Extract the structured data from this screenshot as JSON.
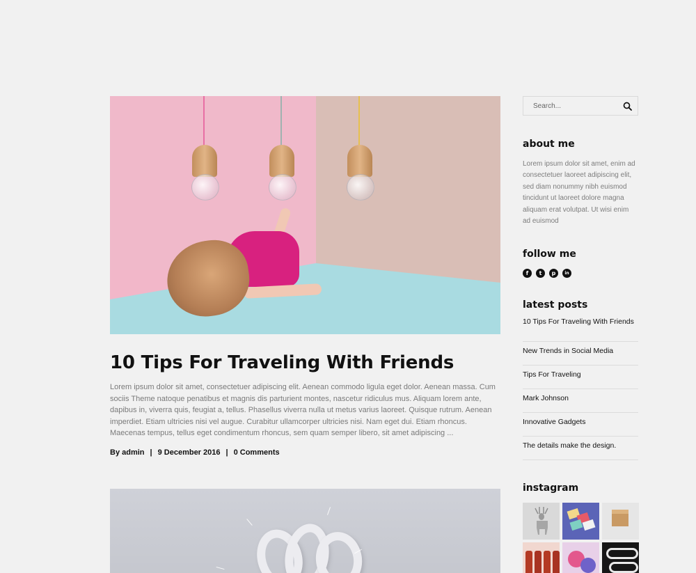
{
  "post1": {
    "title": "10 Tips For Traveling With Friends",
    "excerpt": "Lorem ipsum dolor sit amet, consectetuer adipiscing elit. Aenean commodo ligula eget dolor. Aenean massa. Cum sociis Theme natoque penatibus et magnis dis parturient montes, nascetur ridiculus mus. Aliquam lorem ante, dapibus in, viverra quis, feugiat a, tellus. Phasellus viverra nulla ut metus varius laoreet. Quisque rutrum. Aenean imperdiet. Etiam ultricies nisi vel augue. Curabitur ullamcorper ultricies nisi. Nam eget dui. Etiam rhoncus. Maecenas tempus, tellus eget condimentum rhoncus, sem quam semper libero, sit amet adipiscing ...",
    "meta": {
      "by_label": "By admin",
      "date": "9 December 2016",
      "comments": "0 Comments",
      "separator": "|"
    }
  },
  "sidebar": {
    "search": {
      "placeholder": "Search...",
      "icon": "search-icon"
    },
    "about": {
      "title": "about me",
      "text": "Lorem ipsum dolor sit amet, enim ad consectetuer laoreet adipiscing elit, sed diam nonummy nibh euismod tincidunt ut laoreet dolore magna aliquam erat volutpat. Ut wisi enim ad euismod"
    },
    "follow": {
      "title": "follow me",
      "icons": [
        {
          "name": "facebook-icon",
          "glyph": "f"
        },
        {
          "name": "twitter-icon",
          "glyph": "t"
        },
        {
          "name": "pinterest-icon",
          "glyph": "p"
        },
        {
          "name": "linkedin-icon",
          "glyph": "in"
        }
      ]
    },
    "latest": {
      "title": "latest posts",
      "items": [
        "10 Tips For Traveling With Friends",
        "New Trends in Social Media",
        "Tips For Traveling",
        "Mark Johnson",
        "Innovative Gadgets",
        "The details make the design."
      ]
    },
    "instagram": {
      "title": "instagram"
    }
  },
  "colors": {
    "background": "#f1f1f1",
    "text": "#111111",
    "muted": "#7a7a7a",
    "divider": "#dcdcdc"
  }
}
